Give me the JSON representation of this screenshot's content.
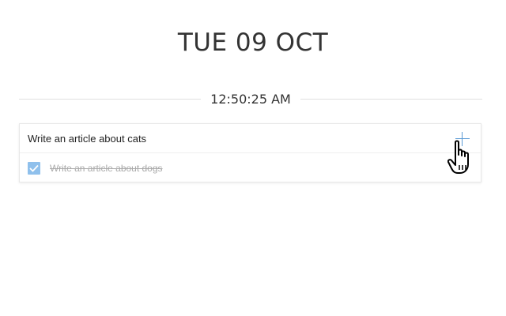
{
  "header": {
    "date": "TUE 09 OCT",
    "time": "12:50:25 AM"
  },
  "todo": {
    "input_value": "Write an article about cats",
    "add_icon": "plus-icon",
    "items": [
      {
        "label": "Write an article about dogs",
        "completed": true
      }
    ]
  },
  "colors": {
    "accent": "#5b9bd5",
    "checkbox_fill": "#8fc0ec",
    "completed_text": "#aaaaaa"
  },
  "cursor": {
    "type": "hand-pointer-icon"
  }
}
